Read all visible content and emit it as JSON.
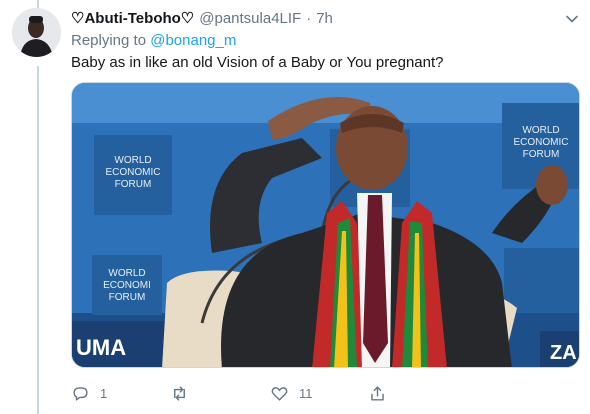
{
  "tweet": {
    "display_name": "♡Abuti-Teboho♡",
    "handle": "@pantsula4LIF",
    "separator": "·",
    "time": "7h",
    "replying_prefix": "Replying to",
    "replying_to": "@bonang_m",
    "text": "Baby as in like an old Vision of  a Baby or You pregnant?"
  },
  "media": {
    "wef_line1": "WORLD",
    "wef_line2": "ECONOMIC",
    "wef_line3": "FORUM",
    "wef_cut_line1": "WORLD",
    "wef_cut_line2": "ECONOMIC",
    "wef_cut_line3": "FORUM",
    "wef_low_line1": "WORLD",
    "wef_low_line2": "ECONOMI",
    "wef_low_line3": "FORUM",
    "banner_left": "UMA",
    "banner_right": "ZA"
  },
  "actions": {
    "reply_count": "1",
    "retweet_count": "",
    "like_count": "11"
  },
  "colors": {
    "accent": "#1da1f2",
    "muted": "#657786",
    "wef_blue": "#2a6fb4"
  }
}
